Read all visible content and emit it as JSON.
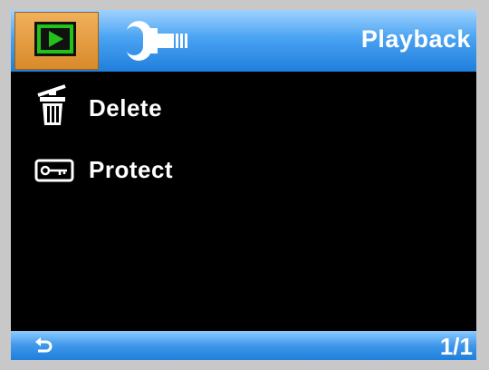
{
  "header": {
    "tabs": [
      {
        "name": "playback",
        "icon": "play-icon",
        "active": true
      },
      {
        "name": "setup",
        "icon": "wrench-icon",
        "active": false
      }
    ],
    "title": "Playback"
  },
  "menu": {
    "items": [
      {
        "label": "Delete",
        "icon": "trash-icon"
      },
      {
        "label": "Protect",
        "icon": "key-icon"
      }
    ]
  },
  "footer": {
    "back_icon": "back-icon",
    "page": "1/1"
  },
  "colors": {
    "header_blue": "#4aa3f2",
    "active_tab_orange": "#d98a2b",
    "play_green": "#22c21a",
    "background": "#000000",
    "text": "#ffffff"
  }
}
